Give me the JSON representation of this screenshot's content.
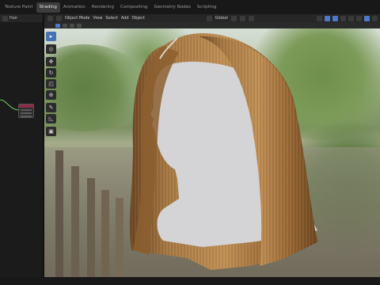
{
  "workspace_tabs": [
    "Texture Paint",
    "Shading",
    "Animation",
    "Rendering",
    "Compositing",
    "Geometry Nodes",
    "Scripting"
  ],
  "active_tab_index": 1,
  "node_editor": {
    "object_label": "Hair"
  },
  "viewport_header": {
    "mode": "Object Mode",
    "menus": [
      "View",
      "Select",
      "Add",
      "Object"
    ],
    "transform_orientation": "Global"
  },
  "toolbar_icons": [
    "select-box-icon",
    "cursor-icon",
    "move-icon",
    "rotate-icon",
    "scale-icon",
    "transform-icon",
    "annotate-icon",
    "measure-icon",
    "add-cube-icon"
  ],
  "colors": {
    "accent": "#4772b3",
    "hair_light": "#b4874f",
    "hair_dark": "#5f3d1f",
    "bust": "#d4d4d6"
  }
}
